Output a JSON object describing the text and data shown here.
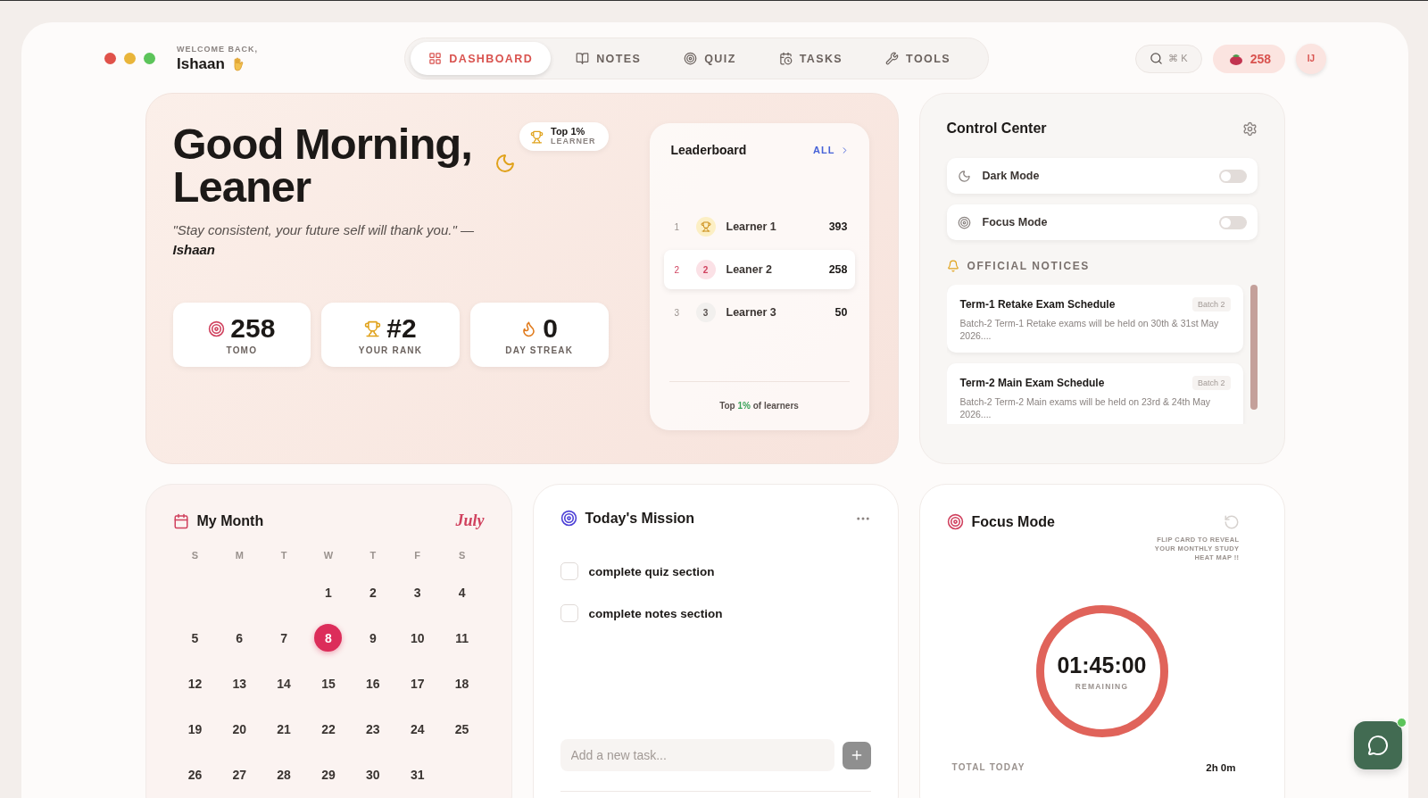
{
  "greeting": {
    "welcome": "WELCOME BACK,",
    "name": "Ishaan"
  },
  "nav": [
    {
      "label": "DASHBOARD",
      "selected": true
    },
    {
      "label": "NOTES",
      "selected": false
    },
    {
      "label": "QUIZ",
      "selected": false
    },
    {
      "label": "TASKS",
      "selected": false
    },
    {
      "label": "TOOLS",
      "selected": false
    }
  ],
  "search": {
    "shortcut": "⌘ K"
  },
  "tomo_badge": "258",
  "avatar": "IJ",
  "hero": {
    "title_lines": [
      "Good Morning,",
      "Leaner"
    ],
    "quote": "\"Stay consistent, your future self will thank you.\" —",
    "author": "Ishaan",
    "badge_top": "Top 1%",
    "badge_bottom": "LEARNER",
    "stats": [
      {
        "value": "258",
        "label": "TOMO"
      },
      {
        "value": "#2",
        "label": "YOUR RANK"
      },
      {
        "value": "0",
        "label": "DAY STREAK"
      }
    ]
  },
  "leaderboard": {
    "title": "Leaderboard",
    "link": "ALL",
    "footer_before": "Top",
    "footer_highlight": "1%",
    "footer_after": "of learners",
    "rows": [
      {
        "rank": "1",
        "kind": "trophy",
        "name": "Learner 1",
        "score": "393",
        "selected": false
      },
      {
        "rank": "2",
        "kind": "number",
        "badge": "2",
        "name": "Leaner 2",
        "score": "258",
        "selected": true
      },
      {
        "rank": "3",
        "kind": "number",
        "badge": "3",
        "name": "Learner 3",
        "score": "50",
        "selected": false
      }
    ]
  },
  "control_center": {
    "title": "Control Center",
    "toggles": [
      {
        "label": "Dark Mode",
        "on": false
      },
      {
        "label": "Focus Mode",
        "on": false
      }
    ],
    "notices_title": "OFFICIAL NOTICES",
    "notices": [
      {
        "title": "Term-1 Retake Exam Schedule",
        "tag": "Batch 2",
        "body": "Batch-2 Term-1 Retake exams will be held on 30th & 31st May 2026...."
      },
      {
        "title": "Term-2 Main Exam Schedule",
        "tag": "Batch 2",
        "body": "Batch-2 Term-2 Main exams will be held on 23rd & 24th May 2026...."
      }
    ]
  },
  "calendar": {
    "title": "My Month",
    "month": "July",
    "weekdays": [
      "S",
      "M",
      "T",
      "W",
      "T",
      "F",
      "S"
    ],
    "weeks": [
      [
        {
          "day": "1",
          "selected": false
        },
        {
          "day": "2",
          "selected": false
        },
        {
          "day": "3",
          "selected": false
        },
        {
          "day": "4",
          "selected": false
        }
      ],
      [
        {
          "day": "5",
          "selected": false
        },
        {
          "day": "6",
          "selected": false
        },
        {
          "day": "7",
          "selected": false
        },
        {
          "day": "8",
          "selected": true
        },
        {
          "day": "9",
          "selected": false
        },
        {
          "day": "10",
          "selected": false
        },
        {
          "day": "11",
          "selected": false
        }
      ],
      [
        {
          "day": "12",
          "selected": false
        },
        {
          "day": "13",
          "selected": false
        },
        {
          "day": "14",
          "selected": false
        },
        {
          "day": "15",
          "selected": false
        },
        {
          "day": "16",
          "selected": false
        },
        {
          "day": "17",
          "selected": false
        },
        {
          "day": "18",
          "selected": false
        }
      ],
      [
        {
          "day": "19",
          "selected": false
        },
        {
          "day": "20",
          "selected": false
        },
        {
          "day": "21",
          "selected": false
        },
        {
          "day": "22",
          "selected": false
        },
        {
          "day": "23",
          "selected": false
        },
        {
          "day": "24",
          "selected": false
        },
        {
          "day": "25",
          "selected": false
        }
      ],
      [
        {
          "day": "26",
          "selected": false
        },
        {
          "day": "27",
          "selected": false
        },
        {
          "day": "28",
          "selected": false
        },
        {
          "day": "29",
          "selected": false
        },
        {
          "day": "30",
          "selected": false
        },
        {
          "day": "31",
          "selected": false
        }
      ]
    ]
  },
  "mission": {
    "title": "Today's Mission",
    "tasks": [
      {
        "label": "complete quiz section",
        "checked": false
      },
      {
        "label": "complete notes section",
        "checked": false
      }
    ],
    "placeholder": "Add a new task..."
  },
  "focus": {
    "title": "Focus Mode",
    "hint": "FLIP CARD TO REVEAL YOUR MONTHLY STUDY HEAT MAP !!",
    "time": "01:45:00",
    "time_label": "REMAINING",
    "total_label": "TOTAL TODAY",
    "total_value": "2h 0m"
  }
}
